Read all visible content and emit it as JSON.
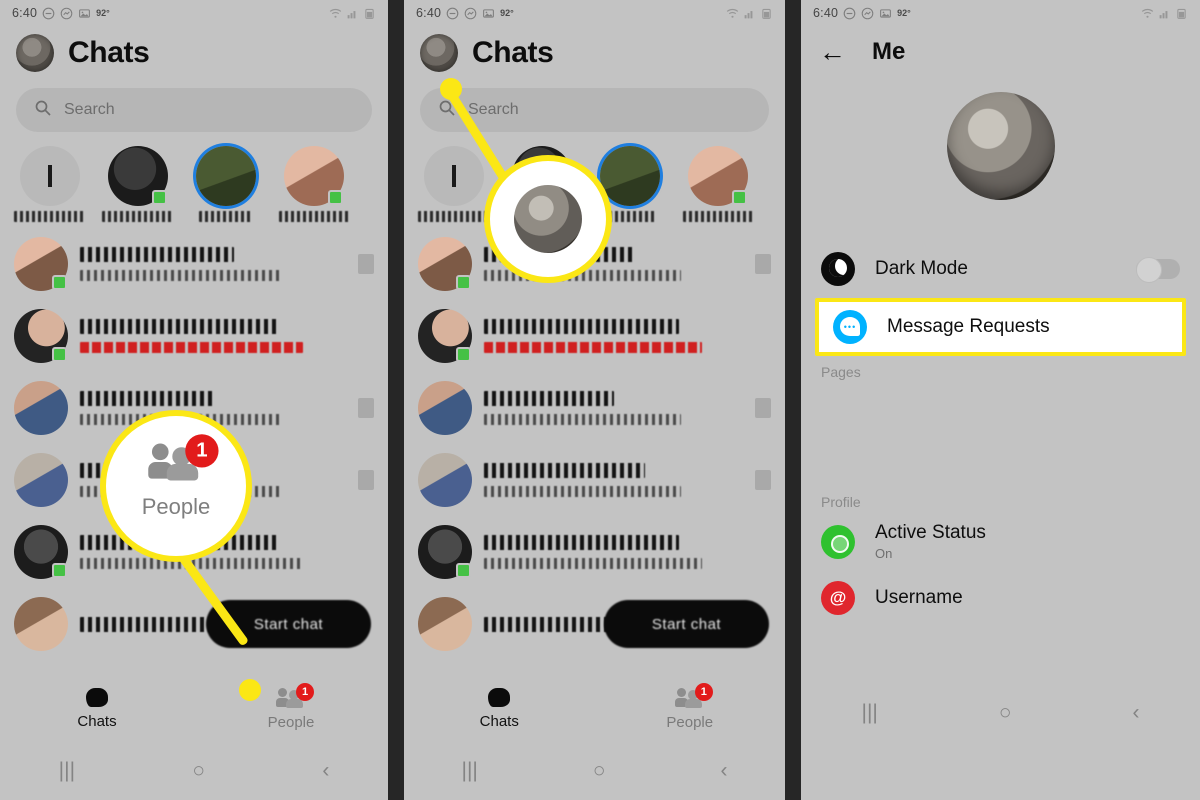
{
  "meta": {
    "accent_yellow": "#fbe715",
    "badge_red": "#e21b1b",
    "messenger_blue": "#00b2ff",
    "active_green": "#2fc12f",
    "username_red": "#e0262d",
    "panel_bg": "#c3c3c3",
    "separator": "#262626"
  },
  "status_bar": {
    "time": "6:40",
    "temperature": "92°",
    "icons_left": [
      "do-not-disturb-icon",
      "messenger-icon",
      "image-icon"
    ],
    "icons_right": [
      "wifi-icon",
      "cell-signal-icon",
      "battery-icon"
    ]
  },
  "panel1": {
    "header": {
      "title": "Chats",
      "avatar": "user-avatar"
    },
    "search": {
      "placeholder": "Search",
      "icon": "search-icon"
    },
    "stories": [
      {
        "name_redacted": true,
        "has_ring": false,
        "online": false,
        "is_your_story": true
      },
      {
        "name_redacted": true,
        "has_ring": false,
        "online": true,
        "is_your_story": false
      },
      {
        "name_redacted": true,
        "has_ring": true,
        "online": false,
        "is_your_story": false
      },
      {
        "name_redacted": true,
        "has_ring": false,
        "online": true,
        "is_your_story": false
      }
    ],
    "chat_rows": [
      {
        "name_redacted": true,
        "preview_redacted": true,
        "online": true,
        "has_thumb": true
      },
      {
        "name_redacted": true,
        "preview_redacted": true,
        "online": true,
        "has_reaction": true
      },
      {
        "name_redacted": true,
        "preview_redacted": true,
        "online": false,
        "has_thumb": true
      },
      {
        "name_redacted": true,
        "preview_redacted": true,
        "online": false,
        "has_thumb": true
      },
      {
        "name_redacted": true,
        "preview_redacted": true,
        "online": true,
        "has_thumb": false
      },
      {
        "name_redacted": true,
        "preview_redacted": true,
        "online": false,
        "has_thumb": false
      }
    ],
    "start_chat": {
      "label": "Start chat",
      "redacted": true
    },
    "bottom_nav": [
      {
        "label": "Chats",
        "icon": "chat-bubble-icon",
        "active": true,
        "badge": null
      },
      {
        "label": "People",
        "icon": "people-icon",
        "active": false,
        "badge": "1"
      }
    ],
    "callout": {
      "magnified_label": "People",
      "magnified_badge": "1",
      "magnified_icon": "people-icon"
    }
  },
  "panel2": {
    "header": {
      "title": "Chats",
      "avatar": "user-avatar"
    },
    "search": {
      "placeholder": "Search",
      "icon": "search-icon"
    },
    "stories": [
      {
        "name_redacted": true,
        "has_ring": false,
        "online": false,
        "is_your_story": true
      },
      {
        "name_redacted": true,
        "has_ring": false,
        "online": true,
        "is_your_story": false
      },
      {
        "name_redacted": true,
        "has_ring": true,
        "online": false,
        "is_your_story": false
      },
      {
        "name_redacted": true,
        "has_ring": false,
        "online": true,
        "is_your_story": false
      }
    ],
    "chat_rows": [
      {
        "name_redacted": true,
        "preview_redacted": true,
        "online": true,
        "has_thumb": true
      },
      {
        "name_redacted": true,
        "preview_redacted": true,
        "online": true,
        "has_reaction": true
      },
      {
        "name_redacted": true,
        "preview_redacted": true,
        "online": false,
        "has_thumb": true
      },
      {
        "name_redacted": true,
        "preview_redacted": true,
        "online": false,
        "has_thumb": true
      },
      {
        "name_redacted": true,
        "preview_redacted": true,
        "online": true,
        "has_thumb": false
      },
      {
        "name_redacted": true,
        "preview_redacted": true,
        "online": false,
        "has_thumb": false
      }
    ],
    "start_chat": {
      "label": "Start chat",
      "redacted": true
    },
    "bottom_nav": [
      {
        "label": "Chats",
        "icon": "chat-bubble-icon",
        "active": true,
        "badge": null
      },
      {
        "label": "People",
        "icon": "people-icon",
        "active": false,
        "badge": "1"
      }
    ],
    "callout": {
      "magnified_icon": "profile-avatar"
    }
  },
  "panel3": {
    "header": {
      "title": "Me",
      "back_icon": "back-arrow-icon"
    },
    "profile_photo": "profile-photo",
    "settings": [
      {
        "label": "Dark Mode",
        "icon": "moon-icon",
        "toggle": "off",
        "highlighted": false
      },
      {
        "label": "Message Requests",
        "icon": "message-requests-icon",
        "highlighted": true
      }
    ],
    "sections": [
      {
        "header": "Pages",
        "items": []
      },
      {
        "header": "Profile",
        "items": [
          {
            "label": "Active Status",
            "sub": "On",
            "icon": "active-status-icon"
          },
          {
            "label": "Username",
            "sub": "",
            "icon": "at-sign-icon"
          }
        ]
      }
    ]
  },
  "android_nav": {
    "recents": "|||",
    "home": "○",
    "back": "‹"
  }
}
